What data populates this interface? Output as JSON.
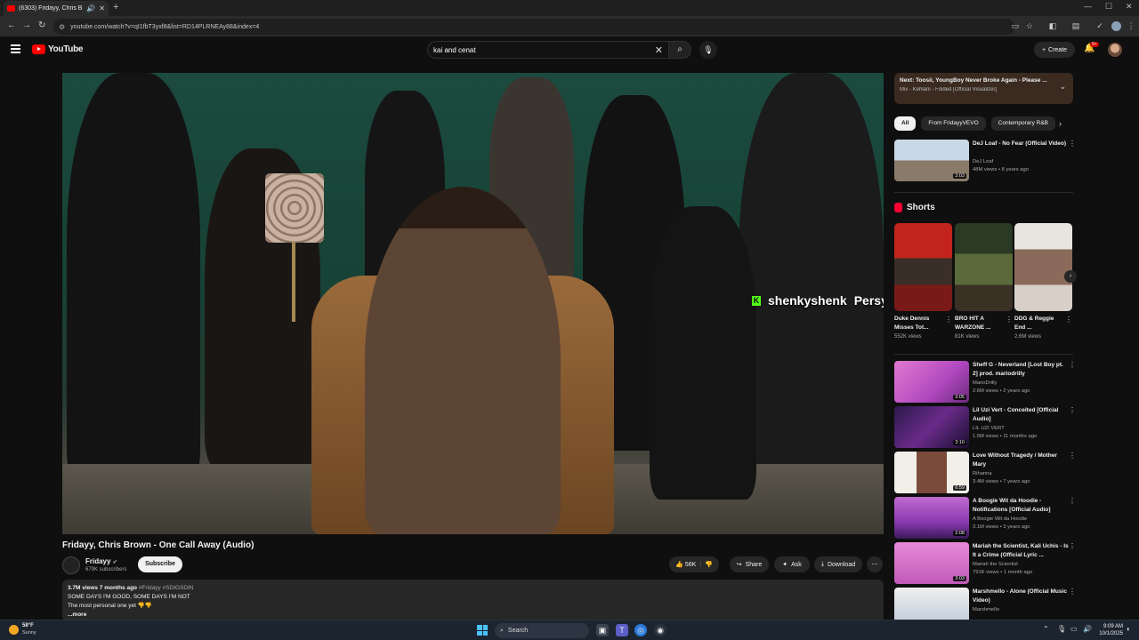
{
  "browser": {
    "tab_title": "(6303) Fridayy, Chris Brown",
    "new_tab_label": "+",
    "url": "youtube.com/watch?v=qI1fbT3yxf8&list=RD14PLRNEAy88&index=4"
  },
  "header": {
    "logo_text": "YouTube",
    "search_query": "kai and cenat",
    "create_label": "Create",
    "notif_count": "9+"
  },
  "player": {
    "chat_user": "shenkyshenk",
    "chat_message": "Persyyyyyyyy"
  },
  "video": {
    "title": "Fridayy, Chris Brown - One Call Away (Audio)",
    "channel": "Fridayy",
    "subscribers": "679K subscribers",
    "subscribe_label": "Subscribe",
    "likes": "56K",
    "share_label": "Share",
    "ask_label": "Ask",
    "download_label": "Download",
    "description": {
      "meta": "3.7M views  7 months ago",
      "tags": "#Fridayy #SDIGSDIN",
      "line1": "SOME DAYS I'M GOOD, SOME DAYS I'M NOT",
      "line2": "The most personal one yet",
      "more": "...more"
    }
  },
  "sidebar": {
    "next": {
      "line1_prefix": "Next: ",
      "line1": "Toosii, YoungBoy Never Broke Again - Please ...",
      "line2": "Mix - Kehlani - Folded [Official Visualizer]"
    },
    "chips": [
      "All",
      "From FridayyVEVO",
      "Contemporary R&B"
    ],
    "top_video": {
      "title": "DeJ Loaf - No Fear (Official Video)",
      "channel": "DeJ Loaf",
      "views": "48M views • 8 years ago",
      "duration": "3:03"
    },
    "shorts_label": "Shorts",
    "shorts": [
      {
        "title": "Duke Dennis Misses Tot...",
        "views": "552K views"
      },
      {
        "title": "BRO HIT A WARZONE ...",
        "views": "81K views"
      },
      {
        "title": "DDG & Reggie End ...",
        "views": "2.6M views"
      }
    ],
    "videos": [
      {
        "title": "Sheff G - Neverland [Lost Boy pt. 2] prod. mariodrilly",
        "channel": "MarioDrilly",
        "views": "2.6M views • 2 years ago",
        "duration": "3:05"
      },
      {
        "title": "Lil Uzi Vert - Conceited [Official Audio]",
        "channel": "LIL UZI VERT",
        "views": "1.5M views • 11 months ago",
        "duration": "3:10"
      },
      {
        "title": "Love Without Tragedy / Mother Mary",
        "channel": "Rihanna",
        "views": "3.4M views • 7 years ago",
        "duration": "6:59"
      },
      {
        "title": "A Boogie Wit da Hoodie - Notifications [Official Audio]",
        "channel": "A Boogie Wit da Hoodie",
        "views": "3.1M views • 3 years ago",
        "duration": "2:08"
      },
      {
        "title": "Mariah the Scientist, Kali Uchis - Is It a Crime (Official Lyric ...",
        "channel": "Mariah the Scientist",
        "views": "791K views • 1 month ago",
        "duration": "3:03"
      },
      {
        "title": "Marshmello - Alone (Official Music Video)",
        "channel": "Marshmello",
        "views": "",
        "duration": ""
      }
    ]
  },
  "taskbar": {
    "temp": "58°F",
    "condition": "Sunny",
    "search_label": "Search",
    "time": "9:09 AM",
    "date": "10/1/2025"
  }
}
